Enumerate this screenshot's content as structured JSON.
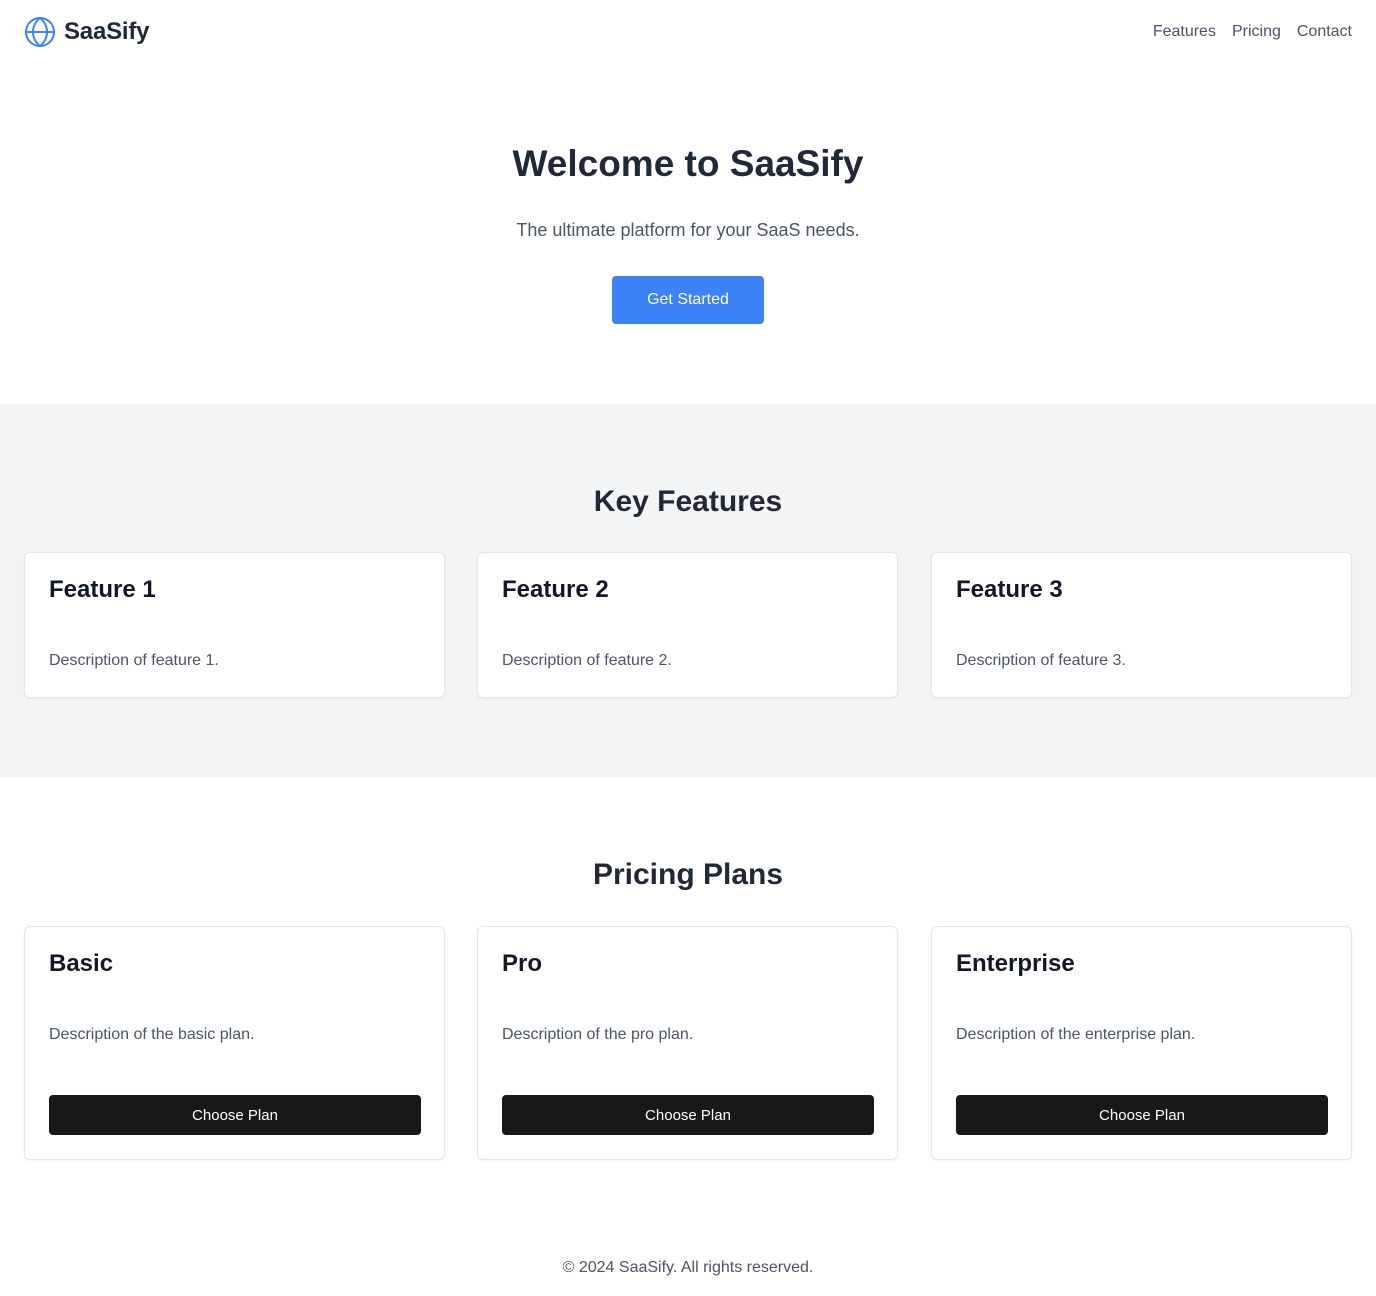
{
  "header": {
    "brand": "SaaSify",
    "nav": [
      {
        "label": "Features"
      },
      {
        "label": "Pricing"
      },
      {
        "label": "Contact"
      }
    ]
  },
  "hero": {
    "title": "Welcome to SaaSify",
    "subtitle": "The ultimate platform for your SaaS needs.",
    "cta_label": "Get Started"
  },
  "features": {
    "title": "Key Features",
    "items": [
      {
        "title": "Feature 1",
        "description": "Description of feature 1."
      },
      {
        "title": "Feature 2",
        "description": "Description of feature 2."
      },
      {
        "title": "Feature 3",
        "description": "Description of feature 3."
      }
    ]
  },
  "pricing": {
    "title": "Pricing Plans",
    "plans": [
      {
        "name": "Basic",
        "description": "Description of the basic plan.",
        "button_label": "Choose Plan"
      },
      {
        "name": "Pro",
        "description": "Description of the pro plan.",
        "button_label": "Choose Plan"
      },
      {
        "name": "Enterprise",
        "description": "Description of the enterprise plan.",
        "button_label": "Choose Plan"
      }
    ]
  },
  "footer": {
    "text": "© 2024 SaaSify. All rights reserved."
  },
  "colors": {
    "accent": "#3b82f6",
    "dark_button": "#18181b",
    "section_bg": "#f3f4f6"
  },
  "icons": {
    "brand": "globe-icon"
  }
}
